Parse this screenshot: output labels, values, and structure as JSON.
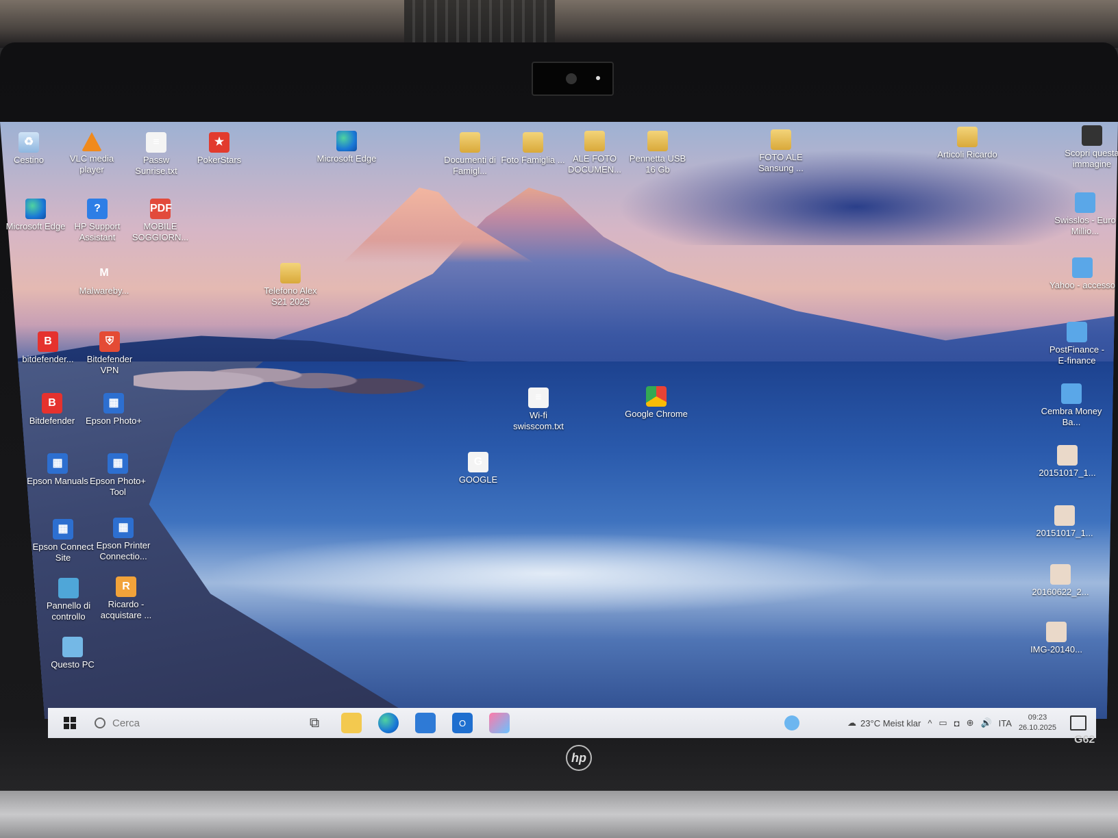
{
  "desktop": {
    "icons": [
      {
        "label": "Cestino",
        "icon": "recycle-bin-icon"
      },
      {
        "label": "VLC media player",
        "icon": "vlc-icon"
      },
      {
        "label": "Passw Sunrise.txt",
        "icon": "text-file-icon"
      },
      {
        "label": "PokerStars",
        "icon": "pokerstars-icon"
      },
      {
        "label": "Microsoft Edge",
        "icon": "edge-icon"
      },
      {
        "label": "Documenti di Famigl...",
        "icon": "folder-icon"
      },
      {
        "label": "Foto Famiglia ...",
        "icon": "folder-icon"
      },
      {
        "label": "ALE FOTO DOCUMEN...",
        "icon": "folder-icon"
      },
      {
        "label": "Pennetta USB 16 Gb",
        "icon": "folder-icon"
      },
      {
        "label": "FOTO ALE Sansung ...",
        "icon": "folder-icon"
      },
      {
        "label": "Articoli Ricardo",
        "icon": "folder-icon"
      },
      {
        "label": "Scopri questa immagine",
        "icon": "camera-icon"
      },
      {
        "label": "Microsoft Edge",
        "icon": "edge-icon"
      },
      {
        "label": "HP Support Assistant",
        "icon": "help-icon"
      },
      {
        "label": "MOBILE SOGGIORN...",
        "icon": "pdf-icon"
      },
      {
        "label": "Swisslos - Euro Millio...",
        "icon": "shortcut-icon"
      },
      {
        "label": "Malwareby...",
        "icon": "malwarebytes-icon"
      },
      {
        "label": "Telefono Alex S21 2025",
        "icon": "folder-icon"
      },
      {
        "label": "Yahoo - accesso",
        "icon": "shortcut-icon"
      },
      {
        "label": "bitdefender...",
        "icon": "bitdefender-icon"
      },
      {
        "label": "Bitdefender VPN",
        "icon": "bitdefender-vpn-icon"
      },
      {
        "label": "PostFinance - E-finance",
        "icon": "shortcut-icon"
      },
      {
        "label": "Bitdefender",
        "icon": "bitdefender-icon"
      },
      {
        "label": "Epson Photo+",
        "icon": "epson-icon"
      },
      {
        "label": "Wi-fi swisscom.txt",
        "icon": "text-file-icon"
      },
      {
        "label": "Google Chrome",
        "icon": "chrome-icon"
      },
      {
        "label": "Cembra Money Ba...",
        "icon": "shortcut-icon"
      },
      {
        "label": "GOOGLE",
        "icon": "web-shortcut-icon"
      },
      {
        "label": "20151017_1...",
        "icon": "photo-icon"
      },
      {
        "label": "Epson Manuals",
        "icon": "epson-icon"
      },
      {
        "label": "Epson Photo+ Tool",
        "icon": "epson-icon"
      },
      {
        "label": "20151017_1...",
        "icon": "photo-icon"
      },
      {
        "label": "Epson Connect Site",
        "icon": "epson-icon"
      },
      {
        "label": "Epson Printer Connectio...",
        "icon": "epson-icon"
      },
      {
        "label": "20160622_2...",
        "icon": "photo-icon"
      },
      {
        "label": "Pannello di controllo",
        "icon": "control-panel-icon"
      },
      {
        "label": "Ricardo - acquistare ...",
        "icon": "ricardo-icon"
      },
      {
        "label": "IMG-20140...",
        "icon": "photo-icon"
      },
      {
        "label": "Questo PC",
        "icon": "computer-icon"
      }
    ]
  },
  "taskbar": {
    "search_placeholder": "Cerca",
    "weather": "23°C  Meist klar",
    "language": "ITA",
    "time": "09:23",
    "date": "26.10.2025"
  },
  "device": {
    "brand": "hp",
    "model": "G62"
  }
}
